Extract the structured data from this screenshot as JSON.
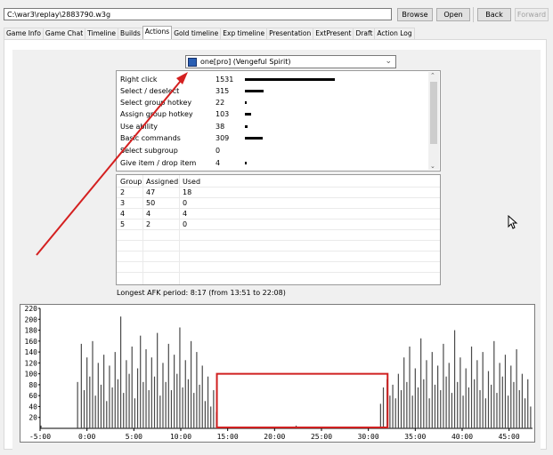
{
  "toolbar": {
    "path_value": "C:\\war3\\replay\\2883790.w3g",
    "browse_label": "Browse",
    "open_label": "Open",
    "back_label": "Back",
    "forward_label": "Forward"
  },
  "tabs": [
    {
      "label": "Game Info",
      "active": false
    },
    {
      "label": "Game Chat",
      "active": false
    },
    {
      "label": "Timeline",
      "active": false
    },
    {
      "label": "Builds",
      "active": false
    },
    {
      "label": "Actions",
      "active": true
    },
    {
      "label": "Gold timeline",
      "active": false
    },
    {
      "label": "Exp timeline",
      "active": false
    },
    {
      "label": "Presentation",
      "active": false
    },
    {
      "label": "ExtPresent",
      "active": false
    },
    {
      "label": "Draft",
      "active": false
    },
    {
      "label": "Action Log",
      "active": false
    }
  ],
  "player_select": {
    "selected": "one[pro] (Vengeful Spirit)",
    "icon": "vengeful-spirit-hero-icon"
  },
  "actions": [
    {
      "name": "Right click",
      "count": "1531",
      "value": 1531
    },
    {
      "name": "Select / deselect",
      "count": "315",
      "value": 315
    },
    {
      "name": "Select group hotkey",
      "count": "22",
      "value": 22
    },
    {
      "name": "Assign group hotkey",
      "count": "103",
      "value": 103
    },
    {
      "name": "Use ability",
      "count": "38",
      "value": 38
    },
    {
      "name": "Basic commands",
      "count": "309",
      "value": 309
    },
    {
      "name": "Select subgroup",
      "count": "0",
      "value": 0
    },
    {
      "name": "Give item / drop item",
      "count": "4",
      "value": 4
    }
  ],
  "groups": {
    "headers": [
      "Group",
      "Assigned",
      "Used"
    ],
    "rows": [
      [
        "2",
        "47",
        "18"
      ],
      [
        "3",
        "50",
        "0"
      ],
      [
        "4",
        "4",
        "4"
      ],
      [
        "5",
        "2",
        "0"
      ]
    ]
  },
  "afk_text": "Longest AFK period: 8:17 (from 13:51 to 22:08)",
  "chart_data": {
    "type": "bar",
    "title": "",
    "xlabel": "",
    "ylabel": "",
    "ylim": [
      0,
      220
    ],
    "xlim": [
      -5,
      47.5
    ],
    "y_ticks": [
      20,
      40,
      60,
      80,
      100,
      120,
      140,
      160,
      180,
      200,
      220
    ],
    "x_tick_values": [
      -5,
      0,
      5,
      10,
      15,
      20,
      25,
      30,
      35,
      40,
      45
    ],
    "x_tick_labels": [
      "-5:00",
      "0:00",
      "5:00",
      "10:00",
      "15:00",
      "20:00",
      "25:00",
      "30:00",
      "35:00",
      "40:00",
      "45:00"
    ],
    "series": [
      {
        "values": [
          {
            "x": -4.9,
            "y": 5
          },
          {
            "x": -1.0,
            "y": 85
          },
          {
            "x": -0.6,
            "y": 155
          },
          {
            "x": -0.3,
            "y": 70
          },
          {
            "x": 0.0,
            "y": 130
          },
          {
            "x": 0.3,
            "y": 95
          },
          {
            "x": 0.6,
            "y": 160
          },
          {
            "x": 0.9,
            "y": 60
          },
          {
            "x": 1.2,
            "y": 120
          },
          {
            "x": 1.5,
            "y": 80
          },
          {
            "x": 1.8,
            "y": 135
          },
          {
            "x": 2.1,
            "y": 50
          },
          {
            "x": 2.4,
            "y": 115
          },
          {
            "x": 2.7,
            "y": 75
          },
          {
            "x": 3.0,
            "y": 140
          },
          {
            "x": 3.3,
            "y": 90
          },
          {
            "x": 3.6,
            "y": 205
          },
          {
            "x": 3.9,
            "y": 65
          },
          {
            "x": 4.2,
            "y": 125
          },
          {
            "x": 4.5,
            "y": 100
          },
          {
            "x": 4.8,
            "y": 150
          },
          {
            "x": 5.1,
            "y": 55
          },
          {
            "x": 5.4,
            "y": 110
          },
          {
            "x": 5.7,
            "y": 170
          },
          {
            "x": 6.0,
            "y": 85
          },
          {
            "x": 6.3,
            "y": 145
          },
          {
            "x": 6.6,
            "y": 70
          },
          {
            "x": 6.9,
            "y": 130
          },
          {
            "x": 7.2,
            "y": 95
          },
          {
            "x": 7.5,
            "y": 175
          },
          {
            "x": 7.8,
            "y": 60
          },
          {
            "x": 8.1,
            "y": 120
          },
          {
            "x": 8.4,
            "y": 85
          },
          {
            "x": 8.7,
            "y": 155
          },
          {
            "x": 9.0,
            "y": 70
          },
          {
            "x": 9.3,
            "y": 135
          },
          {
            "x": 9.6,
            "y": 100
          },
          {
            "x": 9.9,
            "y": 185
          },
          {
            "x": 10.2,
            "y": 75
          },
          {
            "x": 10.5,
            "y": 125
          },
          {
            "x": 10.8,
            "y": 90
          },
          {
            "x": 11.1,
            "y": 160
          },
          {
            "x": 11.4,
            "y": 65
          },
          {
            "x": 11.7,
            "y": 140
          },
          {
            "x": 12.0,
            "y": 80
          },
          {
            "x": 12.3,
            "y": 115
          },
          {
            "x": 12.6,
            "y": 50
          },
          {
            "x": 12.9,
            "y": 95
          },
          {
            "x": 13.2,
            "y": 40
          },
          {
            "x": 13.5,
            "y": 70
          },
          {
            "x": 13.8,
            "y": 30
          },
          {
            "x": 22.3,
            "y": 5
          },
          {
            "x": 31.3,
            "y": 45
          },
          {
            "x": 31.6,
            "y": 75
          },
          {
            "x": 32.0,
            "y": 90
          },
          {
            "x": 32.3,
            "y": 60
          },
          {
            "x": 32.6,
            "y": 80
          },
          {
            "x": 32.9,
            "y": 55
          },
          {
            "x": 33.2,
            "y": 100
          },
          {
            "x": 33.5,
            "y": 70
          },
          {
            "x": 33.8,
            "y": 130
          },
          {
            "x": 34.1,
            "y": 85
          },
          {
            "x": 34.4,
            "y": 150
          },
          {
            "x": 34.7,
            "y": 60
          },
          {
            "x": 35.0,
            "y": 110
          },
          {
            "x": 35.3,
            "y": 75
          },
          {
            "x": 35.6,
            "y": 165
          },
          {
            "x": 35.9,
            "y": 90
          },
          {
            "x": 36.2,
            "y": 125
          },
          {
            "x": 36.5,
            "y": 55
          },
          {
            "x": 36.8,
            "y": 140
          },
          {
            "x": 37.1,
            "y": 80
          },
          {
            "x": 37.4,
            "y": 115
          },
          {
            "x": 37.7,
            "y": 70
          },
          {
            "x": 38.0,
            "y": 155
          },
          {
            "x": 38.3,
            "y": 95
          },
          {
            "x": 38.6,
            "y": 120
          },
          {
            "x": 38.9,
            "y": 65
          },
          {
            "x": 39.2,
            "y": 180
          },
          {
            "x": 39.5,
            "y": 85
          },
          {
            "x": 39.8,
            "y": 130
          },
          {
            "x": 40.1,
            "y": 60
          },
          {
            "x": 40.4,
            "y": 110
          },
          {
            "x": 40.7,
            "y": 75
          },
          {
            "x": 41.0,
            "y": 150
          },
          {
            "x": 41.3,
            "y": 90
          },
          {
            "x": 41.6,
            "y": 125
          },
          {
            "x": 41.9,
            "y": 70
          },
          {
            "x": 42.2,
            "y": 140
          },
          {
            "x": 42.5,
            "y": 55
          },
          {
            "x": 42.8,
            "y": 105
          },
          {
            "x": 43.1,
            "y": 80
          },
          {
            "x": 43.4,
            "y": 160
          },
          {
            "x": 43.7,
            "y": 65
          },
          {
            "x": 44.0,
            "y": 120
          },
          {
            "x": 44.3,
            "y": 95
          },
          {
            "x": 44.6,
            "y": 135
          },
          {
            "x": 44.9,
            "y": 60
          },
          {
            "x": 45.2,
            "y": 115
          },
          {
            "x": 45.5,
            "y": 85
          },
          {
            "x": 45.8,
            "y": 145
          },
          {
            "x": 46.1,
            "y": 70
          },
          {
            "x": 46.4,
            "y": 100
          },
          {
            "x": 46.7,
            "y": 55
          },
          {
            "x": 47.0,
            "y": 90
          },
          {
            "x": 47.3,
            "y": 40
          }
        ]
      }
    ],
    "grid": false,
    "highlight_box": {
      "x": [
        13.85,
        32.05
      ],
      "y": [
        0,
        100
      ],
      "color": "#d02020"
    }
  },
  "annotation": {
    "color": "#d42020"
  }
}
